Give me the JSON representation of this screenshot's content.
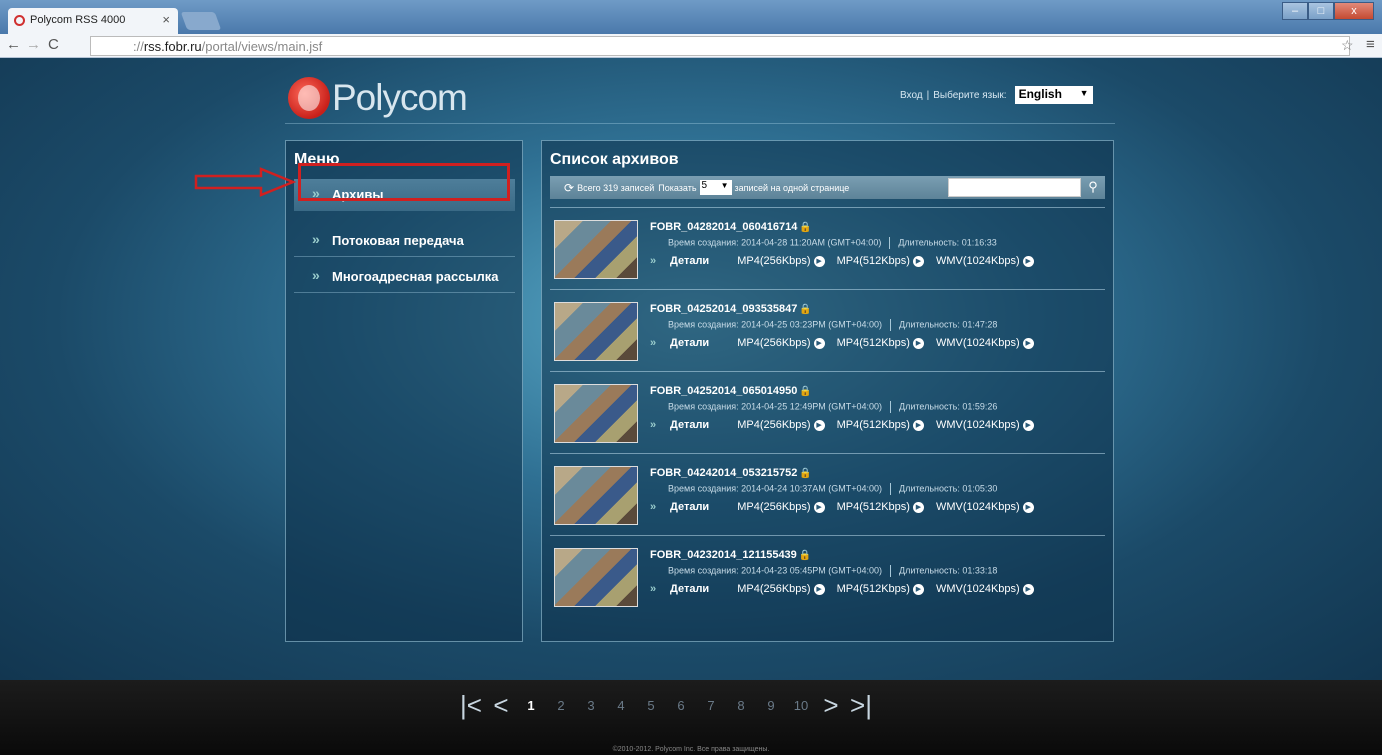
{
  "browser": {
    "tab_title": "Polycom RSS 4000",
    "tab_close": "×",
    "url_prefix": "://",
    "url_host": "rss.fobr.ru",
    "url_path": "/portal/views/main.jsf",
    "window_min": "–",
    "window_max": "□",
    "window_close": "x"
  },
  "header": {
    "logo_text": "Polycom",
    "login": "Вход",
    "separator": "|",
    "language_prompt": "Выберите язык:",
    "language_selected": "English"
  },
  "menu": {
    "title": "Меню",
    "items": [
      {
        "label": "Архивы",
        "active": true
      },
      {
        "label": "Потоковая передача",
        "highlighted": true
      },
      {
        "label": "Многоадресная рассылка"
      }
    ]
  },
  "archives": {
    "title": "Список архивов",
    "total_label": "Всего 319 записей",
    "show_label": "Показать",
    "per_page": "5",
    "per_page_suffix": "записей на одной странице",
    "search_placeholder": "",
    "created_label": "Время создания:",
    "duration_label": "Длительность:",
    "details_label": "Детали",
    "formats": [
      "MP4(256Kbps)",
      "MP4(512Kbps)",
      "WMV(1024Kbps)"
    ],
    "records": [
      {
        "name": "FOBR_04282014_060416714",
        "created": "2014-04-28 11:20AM (GMT+04:00)",
        "duration": "01:16:33"
      },
      {
        "name": "FOBR_04252014_093535847",
        "created": "2014-04-25 03:23PM (GMT+04:00)",
        "duration": "01:47:28"
      },
      {
        "name": "FOBR_04252014_065014950",
        "created": "2014-04-25 12:49PM (GMT+04:00)",
        "duration": "01:59:26"
      },
      {
        "name": "FOBR_04242014_053215752",
        "created": "2014-04-24 10:37AM (GMT+04:00)",
        "duration": "01:05:30"
      },
      {
        "name": "FOBR_04232014_121155439",
        "created": "2014-04-23 05:45PM (GMT+04:00)",
        "duration": "01:33:18"
      }
    ]
  },
  "pager": {
    "first": "|<",
    "prev": "<",
    "pages": [
      "1",
      "2",
      "3",
      "4",
      "5",
      "6",
      "7",
      "8",
      "9",
      "10"
    ],
    "current": "1",
    "next": ">",
    "last": ">|"
  },
  "footer": {
    "copyright": "©2010-2012. Polycom Inc. Все права защищены."
  },
  "colors": {
    "highlight_box": "#d02020",
    "accent_lock": "#e8c020"
  }
}
